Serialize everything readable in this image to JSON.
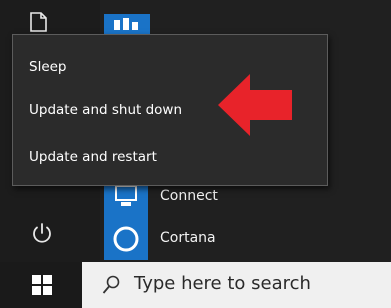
{
  "start_menu": {
    "top_app_label": "",
    "apps": [
      {
        "label": "Connect"
      },
      {
        "label": "Cortana"
      }
    ]
  },
  "power_menu": {
    "items": [
      {
        "label": "Sleep"
      },
      {
        "label": "Update and shut down"
      },
      {
        "label": "Update and restart"
      }
    ],
    "annotation_color": "#e8232a"
  },
  "taskbar": {
    "search_placeholder": "Type here to search"
  },
  "colors": {
    "accent": "#1a73c7",
    "menu_bg": "#2b2b2b",
    "taskbar_bg": "#101010"
  }
}
